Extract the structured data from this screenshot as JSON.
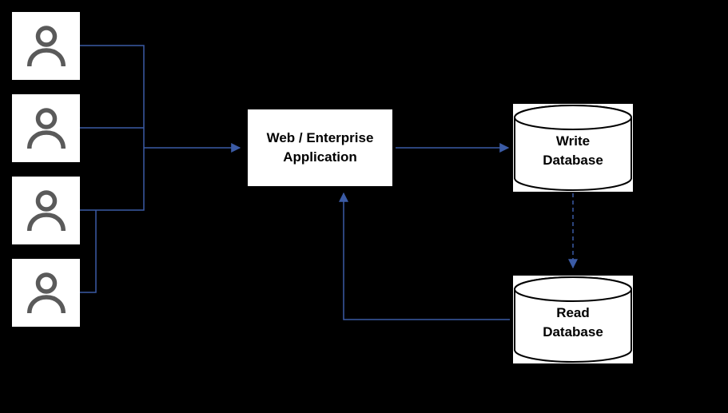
{
  "app": {
    "label": "Web / Enterprise\nApplication"
  },
  "databases": {
    "write": "Write\nDatabase",
    "read": "Read\nDatabase"
  },
  "users_count": 4
}
